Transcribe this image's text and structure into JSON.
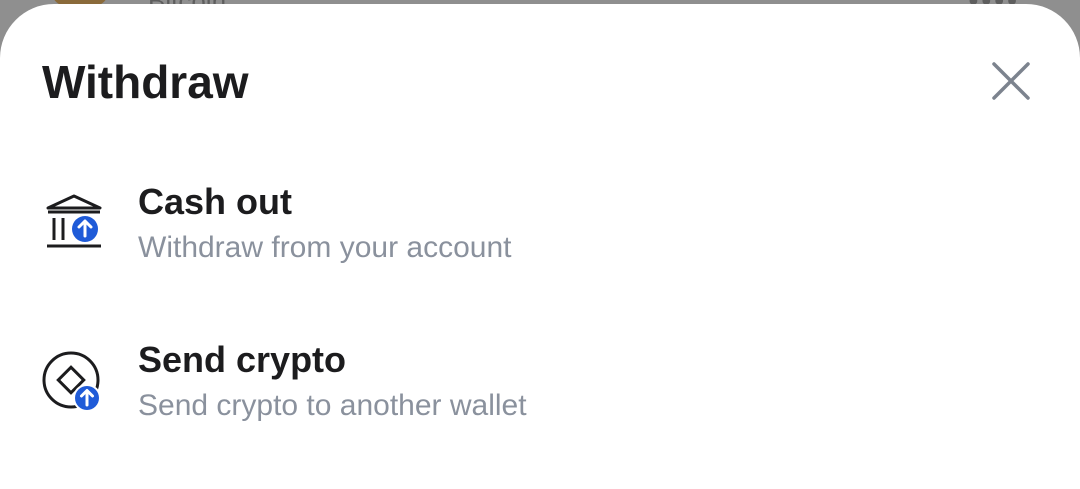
{
  "background": {
    "asset_name": "Bitcoin"
  },
  "sheet": {
    "title": "Withdraw",
    "close_icon": "close-icon",
    "accent_color": "#1f5bd8",
    "options": [
      {
        "label": "Cash out",
        "description": "Withdraw from your account",
        "icon": "bank-upload-icon"
      },
      {
        "label": "Send crypto",
        "description": "Send crypto to another wallet",
        "icon": "crypto-send-icon"
      }
    ]
  }
}
